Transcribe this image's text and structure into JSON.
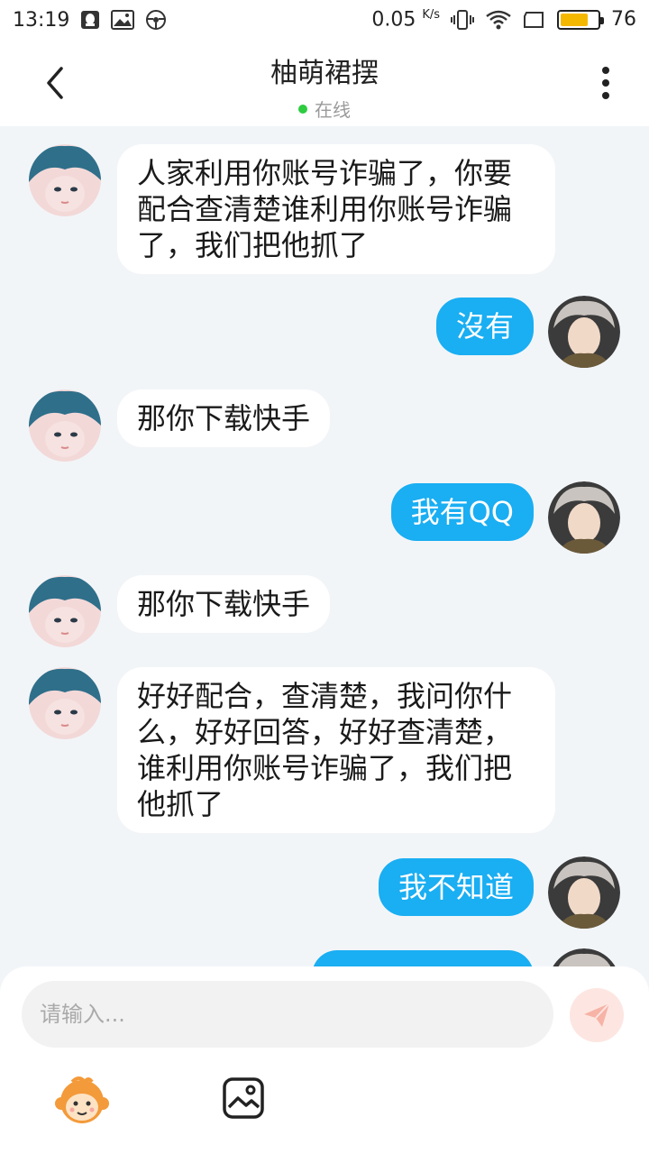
{
  "statusbar": {
    "time": "13:19",
    "network_speed": "0.05",
    "network_unit": "K/s",
    "battery": "76",
    "battery_fill": 0.76,
    "battery_color": "#f5b800"
  },
  "header": {
    "title": "柚萌裙摆",
    "status": "在线",
    "status_color": "#2ecc40"
  },
  "messages": [
    {
      "side": "left",
      "text_lines": [
        "人家利用你账号诈骗了，你要",
        "配合查清楚谁利用你账号诈骗",
        "了，我们把他抓了"
      ]
    },
    {
      "side": "right",
      "text_lines": [
        "沒有"
      ]
    },
    {
      "side": "left",
      "text_lines": [
        "那你下载快手"
      ]
    },
    {
      "side": "right",
      "text_lines": [
        "我有QQ"
      ]
    },
    {
      "side": "left",
      "text_lines": [
        "那你下载快手"
      ]
    },
    {
      "side": "left",
      "text_lines": [
        "好好配合，查清楚，我问你什",
        "么，好好回答，好好查清楚，",
        "谁利用你账号诈骗了，我们把",
        "他抓了"
      ]
    },
    {
      "side": "right",
      "text_lines": [
        "我不知道"
      ]
    }
  ],
  "input": {
    "placeholder": "请输入..."
  },
  "colors": {
    "bubble_sent": "#1aaef2",
    "bubble_received": "#ffffff",
    "background": "#f2f5f8"
  },
  "icons": {
    "back": "chevron-left-icon",
    "more": "more-vertical-icon",
    "send": "paper-plane-icon",
    "emoji": "monkey-emoji-icon",
    "image": "image-icon"
  }
}
